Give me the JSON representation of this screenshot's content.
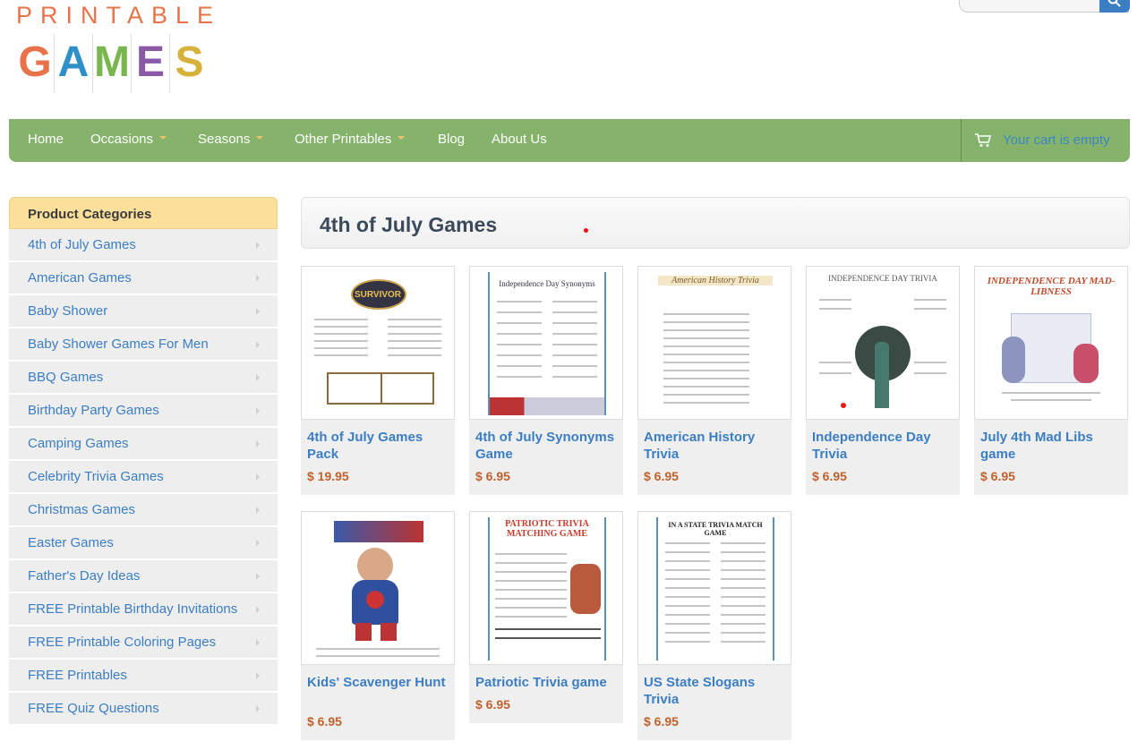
{
  "logo": {
    "top": "PRINTABLE",
    "letters": [
      "G",
      "A",
      "M",
      "E",
      "S"
    ],
    "colors": [
      "#e8734a",
      "#2f8fc9",
      "#7ab650",
      "#8a5aa8",
      "#d7b23b"
    ]
  },
  "search": {
    "placeholder": ""
  },
  "nav": {
    "items": [
      {
        "label": "Home",
        "dropdown": false
      },
      {
        "label": "Occasions",
        "dropdown": true
      },
      {
        "label": "Seasons",
        "dropdown": true
      },
      {
        "label": "Other Printables",
        "dropdown": true
      },
      {
        "label": "Blog",
        "dropdown": false
      },
      {
        "label": "About Us",
        "dropdown": false
      }
    ],
    "cart_text": "Your cart is empty",
    "cart_icon": "cart-icon"
  },
  "sidebar": {
    "title": "Product Categories",
    "items": [
      "4th of July Games",
      "American Games",
      "Baby Shower",
      "Baby Shower Games For Men",
      "BBQ Games",
      "Birthday Party Games",
      "Camping Games",
      "Celebrity Trivia Games",
      "Christmas Games",
      "Easter Games",
      "Father's Day Ideas",
      "FREE Printable Birthday Invitations",
      "FREE Printable Coloring Pages",
      "FREE Printables",
      "FREE Quiz Questions"
    ]
  },
  "main": {
    "title": "4th of July Games",
    "products": [
      {
        "name": "4th of July Games Pack",
        "price": "$ 19.95",
        "thumb": "SURVIVOR"
      },
      {
        "name": "4th of July Synonyms Game",
        "price": "$ 6.95",
        "thumb": "Independence Day Synonyms"
      },
      {
        "name": "American History Trivia",
        "price": "$ 6.95",
        "thumb": "American History Trivia"
      },
      {
        "name": "Independence Day Trivia",
        "price": "$ 6.95",
        "thumb": "INDEPENDENCE DAY TRIVIA"
      },
      {
        "name": "July 4th Mad Libs game",
        "price": "$ 6.95",
        "thumb": "INDEPENDENCE DAY MAD-LIBNESS"
      },
      {
        "name": "Kids' Scavenger Hunt",
        "price": "$ 6.95",
        "thumb": ""
      },
      {
        "name": "Patriotic Trivia game",
        "price": "$ 6.95",
        "thumb": "PATRIOTIC TRIVIA MATCHING GAME"
      },
      {
        "name": "US State Slogans Trivia",
        "price": "$ 6.95",
        "thumb": "IN A STATE TRIVIA MATCH GAME"
      }
    ]
  }
}
